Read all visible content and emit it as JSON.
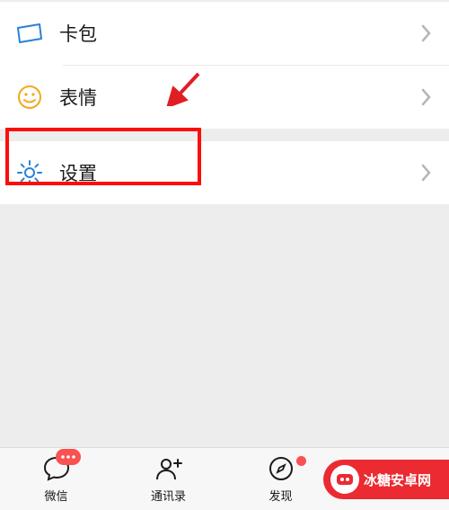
{
  "menu": {
    "cardPkg": {
      "label": "卡包"
    },
    "sticker": {
      "label": "表情"
    },
    "settings": {
      "label": "设置"
    }
  },
  "tabs": {
    "chat": {
      "label": "微信"
    },
    "contacts": {
      "label": "通讯录"
    },
    "discover": {
      "label": "发现"
    },
    "me": {
      "label": ""
    }
  },
  "watermark": {
    "text": "冰糖安卓网"
  },
  "colors": {
    "cardIcon": "#2782d7",
    "stickerIcon": "#f4a71c",
    "gearIcon": "#2782d7",
    "highlight": "#fc0d09",
    "arrow": "#e01e24",
    "badge": "#fa5151",
    "green": "#06c160",
    "wmBg": "#eb2a32"
  }
}
